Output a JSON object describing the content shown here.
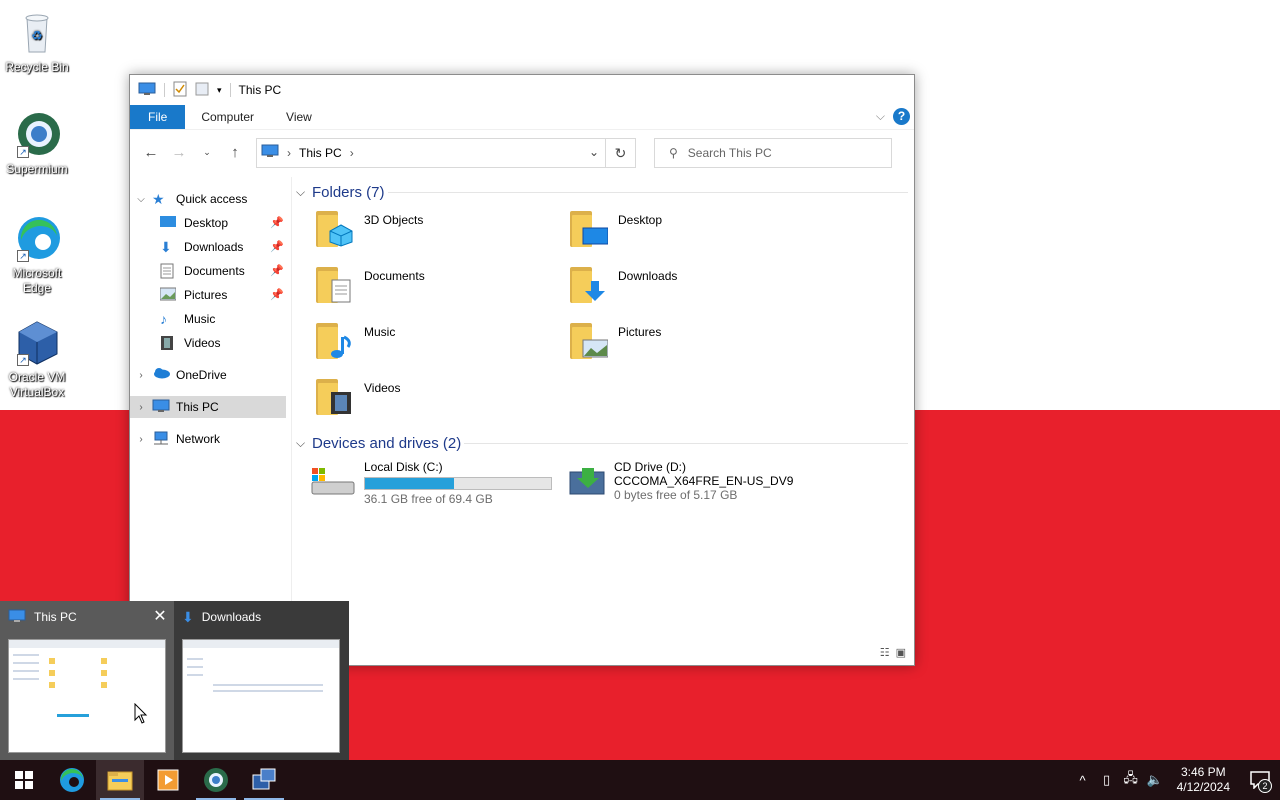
{
  "desktop": {
    "icons": [
      {
        "label": "Recycle Bin",
        "icon": "recycle-bin-icon"
      },
      {
        "label": "Supermium",
        "icon": "supermium-icon"
      },
      {
        "label": "Microsoft Edge",
        "icon": "edge-icon"
      },
      {
        "label": "Oracle VM VirtualBox",
        "icon": "virtualbox-icon"
      }
    ]
  },
  "explorer": {
    "title": "This PC",
    "ribbon": {
      "tabs": [
        "File",
        "Computer",
        "View"
      ],
      "help": "?"
    },
    "address": {
      "crumb": "This PC"
    },
    "search": {
      "placeholder": "Search This PC"
    },
    "nav": {
      "quick_access": "Quick access",
      "quick_items": [
        "Desktop",
        "Downloads",
        "Documents",
        "Pictures",
        "Music",
        "Videos"
      ],
      "onedrive": "OneDrive",
      "this_pc": "This PC",
      "network": "Network"
    },
    "folders_header": "Folders (7)",
    "folders": [
      "3D Objects",
      "Desktop",
      "Documents",
      "Downloads",
      "Music",
      "Pictures",
      "Videos"
    ],
    "drives_header": "Devices and drives (2)",
    "drives": [
      {
        "name": "Local Disk (C:)",
        "free": "36.1 GB free of 69.4 GB",
        "used_fraction": 0.48
      },
      {
        "name": "CD Drive (D:)",
        "label": "CCCOMA_X64FRE_EN-US_DV9",
        "free": "0 bytes free of 5.17 GB"
      }
    ]
  },
  "thumbnails": [
    {
      "title": "This PC",
      "close": "✕"
    },
    {
      "title": "Downloads"
    }
  ],
  "taskbar": {
    "apps": [
      "start",
      "edge",
      "file-explorer",
      "media-player",
      "supermium",
      "virtualbox"
    ],
    "clock_time": "3:46 PM",
    "clock_date": "4/12/2024",
    "notification_count": "2"
  },
  "colors": {
    "accent": "#1979ca",
    "wall_red": "#e8202c",
    "taskbar": "#1f0f12",
    "drive_bar": "#26a0da"
  }
}
